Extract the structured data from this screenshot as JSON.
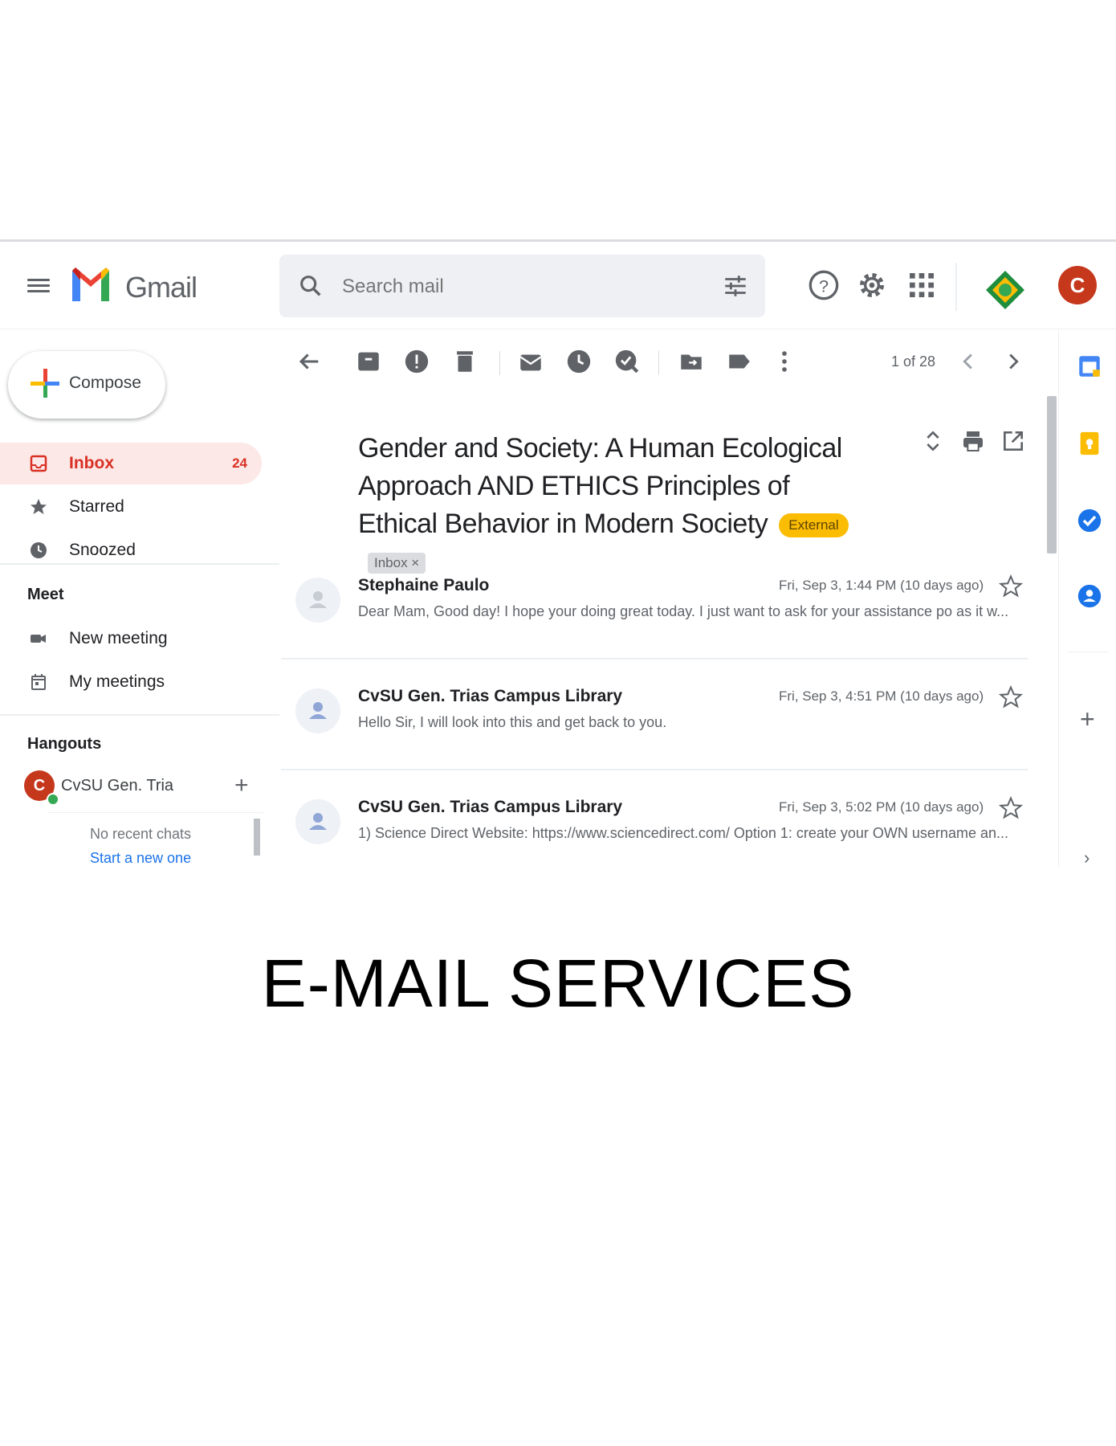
{
  "header": {
    "brand": "Gmail",
    "search_placeholder": "Search mail",
    "account_initial": "C"
  },
  "sidebar": {
    "compose_label": "Compose",
    "items": [
      {
        "label": "Inbox",
        "count": "24",
        "icon": "inbox-icon"
      },
      {
        "label": "Starred",
        "icon": "star-icon"
      },
      {
        "label": "Snoozed",
        "icon": "clock-icon"
      }
    ],
    "meet_title": "Meet",
    "meet_items": [
      {
        "label": "New meeting",
        "icon": "video-icon"
      },
      {
        "label": "My meetings",
        "icon": "calendar-icon"
      }
    ],
    "hangouts_title": "Hangouts",
    "hangouts_user": "CvSU Gen. Tria",
    "hangouts_user_initial": "C",
    "no_recent_chats": "No recent chats",
    "start_new": "Start a new one"
  },
  "toolbar": {
    "pager": "1 of 28"
  },
  "thread": {
    "subject": "Gender and Society: A Human Ecological Approach AND ETHICS Principles of Ethical Behavior in Modern Society",
    "label_external": "External",
    "label_inbox": "Inbox ×"
  },
  "messages": [
    {
      "sender": "Stephaine Paulo",
      "date": "Fri, Sep 3, 1:44 PM (10 days ago)",
      "snippet": "Dear Mam, Good day! I hope your doing great today. I just want to ask for your assistance po as it w..."
    },
    {
      "sender": "CvSU Gen. Trias Campus Library",
      "date": "Fri, Sep 3, 4:51 PM (10 days ago)",
      "snippet": "Hello Sir, I will look into this and get back to you."
    },
    {
      "sender": "CvSU Gen. Trias Campus Library",
      "date": "Fri, Sep 3, 5:02 PM (10 days ago)",
      "snippet": "1) Science Direct Website: https://www.sciencedirect.com/ Option 1: create your OWN username an..."
    }
  ],
  "caption": "E-MAIL SERVICES",
  "colors": {
    "gmail_red": "#ea4335",
    "active_bg": "#fce8e6",
    "external_chip": "#fbbc04",
    "avatar": "#c5381c"
  }
}
